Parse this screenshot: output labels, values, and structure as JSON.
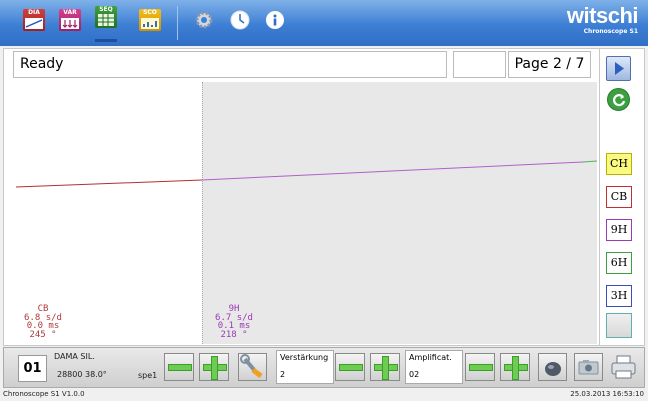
{
  "toolbar": {
    "dia_label": "DIA",
    "var_label": "VAR",
    "seq_label": "SEQ",
    "sco_label": "SCO",
    "icons": [
      "dia-icon",
      "var-icon",
      "seq-icon",
      "sco-icon",
      "gear-icon",
      "clock-icon",
      "info-icon"
    ]
  },
  "brand": {
    "name": "witschi",
    "product": "Chronoscope S1"
  },
  "status": {
    "message": "Ready",
    "page": "Page 2 / 7"
  },
  "readouts": {
    "left": {
      "label": "CB",
      "rate": "6.8 s/d",
      "beat_error": "0.0 ms",
      "amplitude": "245 °",
      "color": "#b03a3a"
    },
    "right": {
      "label": "9H",
      "rate": "6.7 s/d",
      "beat_error": "0.1 ms",
      "amplitude": "218 °",
      "color": "#9b3ab5"
    }
  },
  "side": {
    "buttons": [
      "play-icon",
      "refresh-icon"
    ],
    "channels": [
      {
        "label": "CH",
        "bg": "#fafa80",
        "border": "#b4b400"
      },
      {
        "label": "CB",
        "bg": "#ffffff",
        "border": "#c03030"
      },
      {
        "label": "9H",
        "bg": "#ffffff",
        "border": "#9b3ab5"
      },
      {
        "label": "6H",
        "bg": "#ffffff",
        "border": "#3aa040"
      },
      {
        "label": "3H",
        "bg": "#ffffff",
        "border": "#3a4fb5"
      }
    ]
  },
  "bottom": {
    "channel_number": "01",
    "watch_name": "DAMA SIL.",
    "watch_params": "28800 38.0°",
    "spe": "spe1",
    "verstaerkung_label": "Verstärkung",
    "verstaerkung_value": "2",
    "amplificat_label": "Amplificat.",
    "amplificat_value": "02"
  },
  "footer": {
    "version": "Chronoscope S1 V1.0.0",
    "datetime": "25.03.2013 16:53:10"
  },
  "colors": {
    "trace_left": "#b03030",
    "trace_right": "#b060c8",
    "trace_end": "#50b050"
  }
}
